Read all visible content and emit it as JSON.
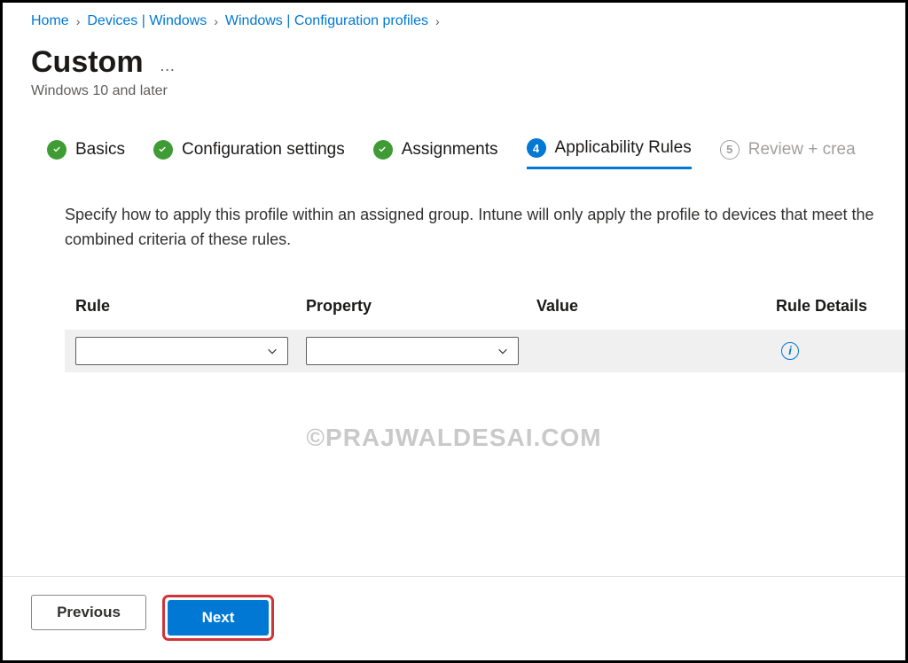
{
  "breadcrumb": {
    "items": [
      "Home",
      "Devices | Windows",
      "Windows | Configuration profiles"
    ]
  },
  "header": {
    "title": "Custom",
    "subtitle": "Windows 10 and later"
  },
  "steps": {
    "s1": {
      "label": "Basics"
    },
    "s2": {
      "label": "Configuration settings"
    },
    "s3": {
      "label": "Assignments"
    },
    "s4": {
      "num": "4",
      "label": "Applicability Rules"
    },
    "s5": {
      "num": "5",
      "label": "Review + crea"
    }
  },
  "description": "Specify how to apply this profile within an assigned group. Intune will only apply the profile to devices that meet the combined criteria of these rules.",
  "table": {
    "headers": {
      "rule": "Rule",
      "property": "Property",
      "value": "Value",
      "details": "Rule Details"
    },
    "row": {
      "rule_value": "",
      "property_value": "",
      "value_value": ""
    }
  },
  "watermark": "©PRAJWALDESAI.COM",
  "footer": {
    "previous": "Previous",
    "next": "Next"
  }
}
